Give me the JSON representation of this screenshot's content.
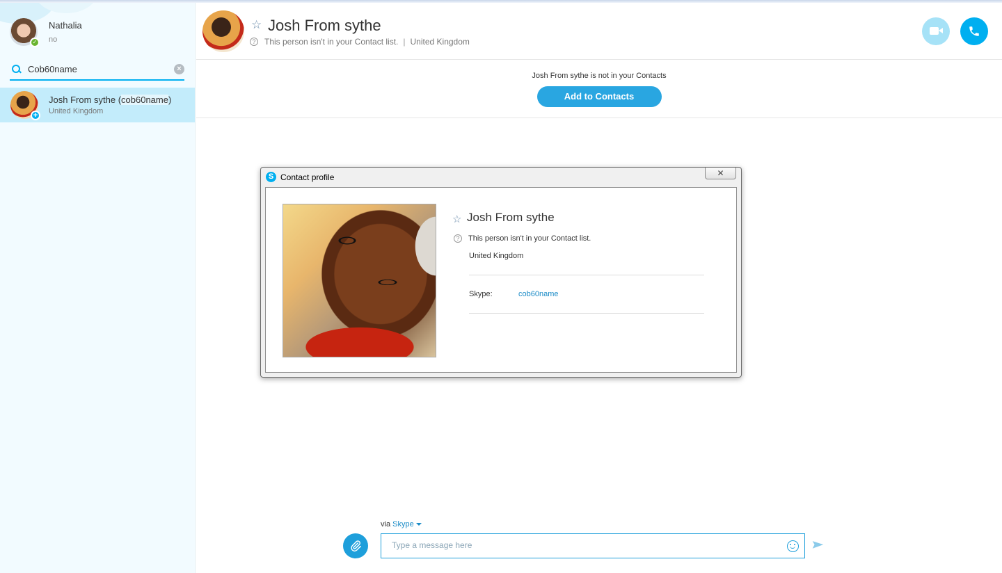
{
  "colors": {
    "accent": "#00aff0",
    "link": "#1a8bc7",
    "selected_row": "#c3ecfb",
    "online": "#6ab530"
  },
  "me": {
    "name": "Nathalia",
    "status": "no",
    "avatar_icon": "user-avatar",
    "presence_icon": "online-check-icon"
  },
  "search": {
    "value": "Cob60name",
    "placeholder": "Search"
  },
  "results": [
    {
      "name": "Josh From sythe (",
      "handle": "cob60name",
      "close": ")",
      "location": "United Kingdom"
    }
  ],
  "header": {
    "name": "Josh From sythe",
    "status": "This person isn't in your Contact list.",
    "separator": "|",
    "location": "United Kingdom"
  },
  "banner": {
    "text": "Josh From sythe is not in your Contacts",
    "button": "Add to Contacts"
  },
  "dialog": {
    "title": "Contact profile",
    "close": "✕",
    "name": "Josh From sythe",
    "status": "This person isn't in your Contact list.",
    "location": "United Kingdom",
    "skype_label": "Skype:",
    "skype_value": "cob60name"
  },
  "composer": {
    "via": "via",
    "network": "Skype",
    "placeholder": "Type a message here"
  }
}
